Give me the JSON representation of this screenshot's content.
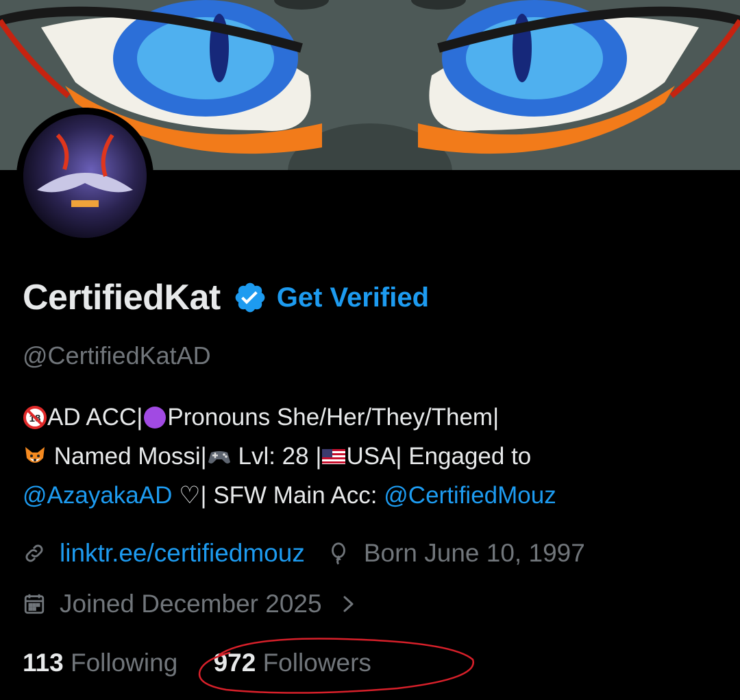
{
  "profile": {
    "display_name": "CertifiedKat",
    "get_verified_label": "Get Verified",
    "handle": "@CertifiedKatAD"
  },
  "bio": {
    "line1_a": "AD ACC|",
    "line1_b": "Pronouns She/Her/They/Them|",
    "line2_a": " Named Mossi|",
    "line2_b": " Lvl: 28 |",
    "line2_c": "USA| Engaged to",
    "mention1": "@AzayakaAD",
    "line3_mid": " ♡| SFW Main Acc: ",
    "mention2": "@CertifiedMouz"
  },
  "meta": {
    "link_text": "linktr.ee/certifiedmouz",
    "birthday": "Born June 10, 1997",
    "joined": "Joined December 2025"
  },
  "stats": {
    "following_count": "113",
    "following_label": "Following",
    "followers_count": "972",
    "followers_label": "Followers"
  },
  "icons": {
    "verified": "verified-badge-icon",
    "link": "link-icon",
    "birthday": "balloon-icon",
    "calendar": "calendar-icon",
    "chevron": "chevron-right-icon"
  },
  "colors": {
    "accent": "#1d9bf0",
    "muted": "#71767b",
    "text": "#e7e9ea",
    "annotation": "#d8202a"
  }
}
